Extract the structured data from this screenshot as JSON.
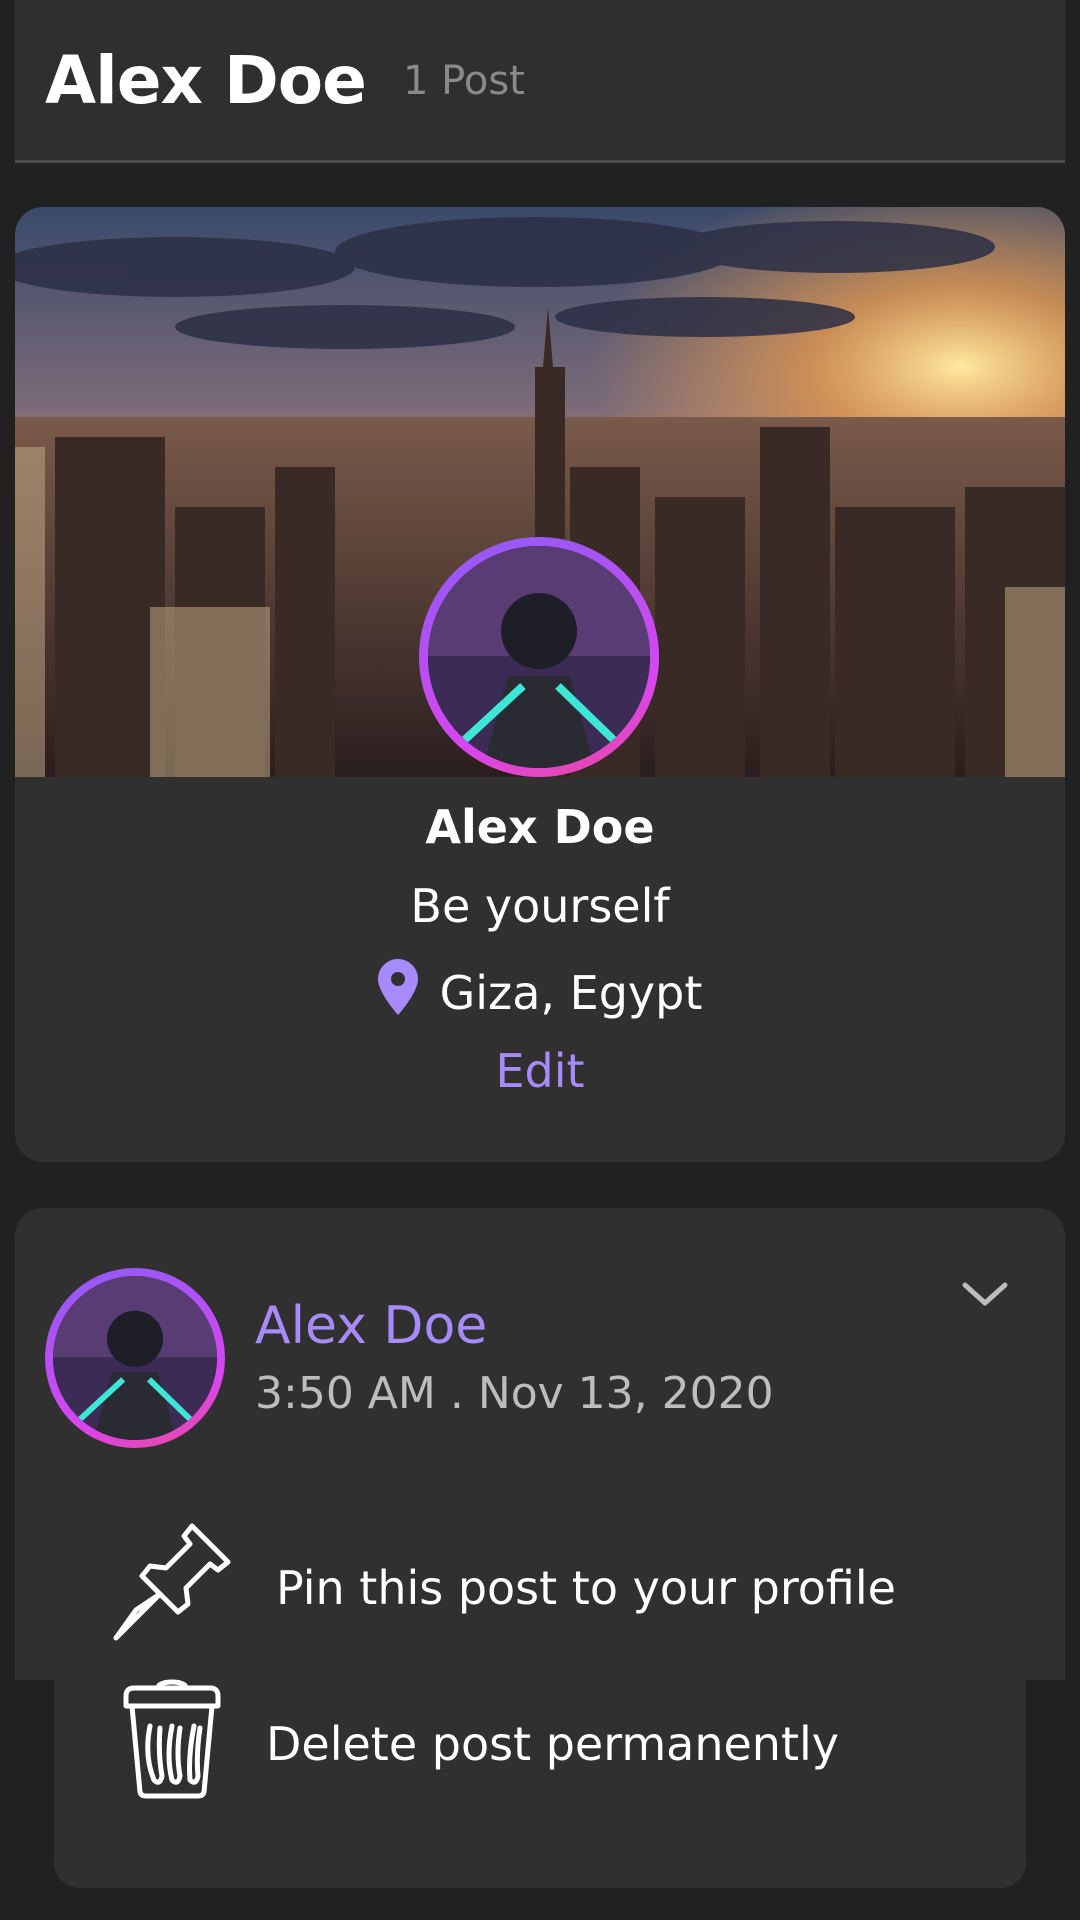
{
  "header": {
    "name": "Alex Doe",
    "post_count": "1 Post"
  },
  "profile": {
    "name": "Alex Doe",
    "bio": "Be yourself",
    "location": "Giza, Egypt",
    "edit_label": "Edit"
  },
  "post": {
    "author": "Alex Doe",
    "timestamp": "3:50 AM . Nov 13, 2020"
  },
  "menu": {
    "pin_label": "Pin this post to your profile",
    "delete_label": "Delete post permanently"
  },
  "colors": {
    "accent": "#a78bfa",
    "background": "#212121",
    "card": "#303030",
    "avatar_ring_start": "#8b5cf6",
    "avatar_ring_end": "#ec4899"
  },
  "icons": [
    "location-pin-icon",
    "chevron-down-icon",
    "pushpin-icon",
    "trash-icon"
  ]
}
